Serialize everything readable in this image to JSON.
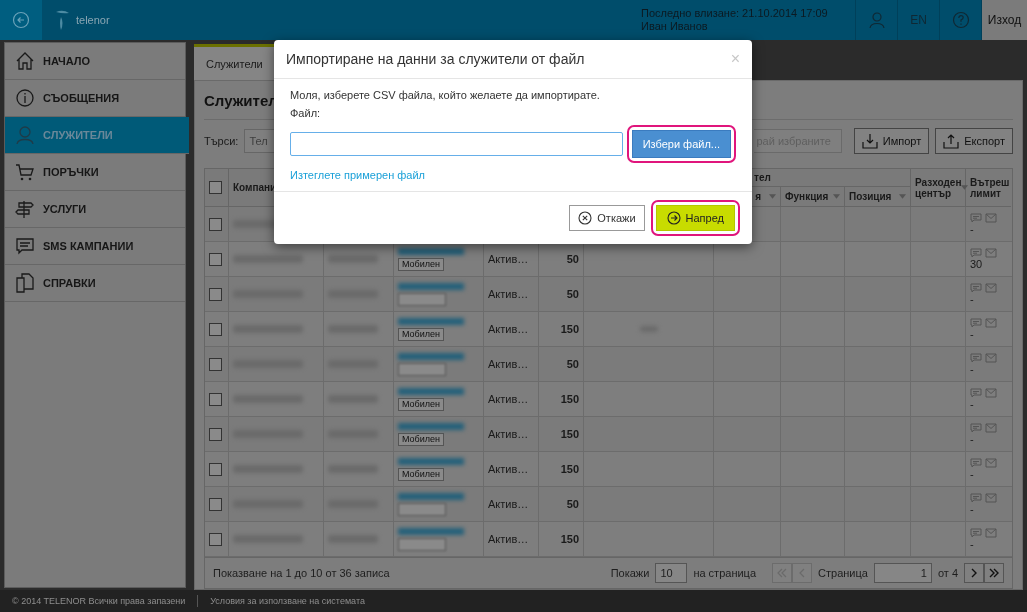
{
  "header": {
    "logo_text": "telenor",
    "last_login": "Последно влизане: 21.10.2014 17:09",
    "user_name": "Иван Иванов",
    "language": "EN",
    "logout": "Изход"
  },
  "sidebar": {
    "items": [
      {
        "kind": "home",
        "label": "НАЧАЛО",
        "selected": false
      },
      {
        "kind": "info",
        "label": "СЪОБЩЕНИЯ",
        "selected": false
      },
      {
        "kind": "user",
        "label": "СЛУЖИТЕЛИ",
        "selected": true
      },
      {
        "kind": "cart",
        "label": "ПОРЪЧКИ",
        "selected": false
      },
      {
        "kind": "sign",
        "label": "УСЛУГИ",
        "selected": false
      },
      {
        "kind": "chat",
        "label": "SMS КАМПАНИИ",
        "selected": false
      },
      {
        "kind": "docs",
        "label": "СПРАВКИ",
        "selected": false
      }
    ]
  },
  "tabs": [
    {
      "label": "Служители",
      "selected": true
    }
  ],
  "page_title": "Служител",
  "toolbar": {
    "search_label": "Търси:",
    "search_placeholder": "Тел",
    "bulk_button": "рай избраните",
    "import_button": "Импорт",
    "export_button": "Експорт"
  },
  "table": {
    "header_checked": false,
    "company_header": "Компани",
    "group_header": "тел",
    "sub_headers": [
      "я",
      "Функция",
      "Позиция"
    ],
    "cost_center_header": "Разходен\nцентър",
    "limit_header": "Вътреш\nлимит",
    "rows": [
      {
        "checked": false,
        "limit": "-"
      },
      {
        "checked": false,
        "tag": "Мобилен",
        "status": "Актив…",
        "amount": "50",
        "limit": "30"
      },
      {
        "checked": false,
        "status": "Актив…",
        "amount": "50",
        "limit": "-"
      },
      {
        "checked": false,
        "tag": "Мобилен",
        "status": "Актив…",
        "amount": "150",
        "limit": "-",
        "note": true
      },
      {
        "checked": false,
        "status": "Актив…",
        "amount": "50",
        "limit": "-"
      },
      {
        "checked": false,
        "tag": "Мобилен",
        "status": "Актив…",
        "amount": "150",
        "limit": "-"
      },
      {
        "checked": false,
        "tag": "Мобилен",
        "status": "Актив…",
        "amount": "150",
        "limit": "-"
      },
      {
        "checked": false,
        "tag": "Мобилен",
        "status": "Актив…",
        "amount": "150",
        "limit": "-"
      },
      {
        "checked": false,
        "status": "Актив…",
        "amount": "50",
        "limit": "-"
      },
      {
        "checked": false,
        "status": "Актив…",
        "amount": "150",
        "limit": "-"
      }
    ]
  },
  "pagination": {
    "summary": "Показване на 1 до 10 от 36 записа",
    "show_label": "Покажи",
    "page_size": "10",
    "per_page_label": "на страница",
    "page_label": "Страница",
    "page": "1",
    "of_label": "от 4"
  },
  "footer": {
    "copyright": "© 2014 TELENOR Всички права запазени",
    "terms": "Условия за използване на системата"
  },
  "dialog": {
    "title": "Импортиране на данни за служители от файл",
    "close": "×",
    "message": "Моля, изберете CSV файла, който желаете да импортирате.",
    "file_label": "Файл:",
    "choose_button": "Избери файл...",
    "sample_link": "Изтеглете примерен файл",
    "cancel_button": "Откажи",
    "next_button": "Напред"
  }
}
